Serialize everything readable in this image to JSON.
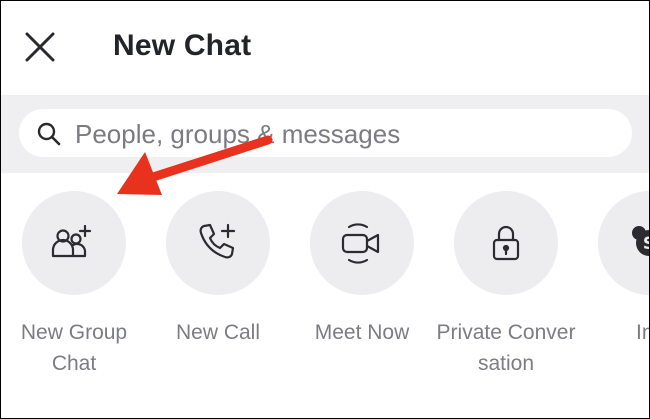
{
  "header": {
    "title": "New Chat",
    "close_icon": "close-icon"
  },
  "search": {
    "placeholder": "People, groups & messages",
    "icon": "search-icon"
  },
  "actions": [
    {
      "label": "New Group Chat",
      "icon": "group-add-icon"
    },
    {
      "label": "New Call",
      "icon": "phone-add-icon"
    },
    {
      "label": "Meet Now",
      "icon": "video-camera-icon"
    },
    {
      "label": "Private Conversation",
      "icon": "lock-icon"
    },
    {
      "label": "Inv",
      "icon": "skype-icon"
    }
  ],
  "colors": {
    "title": "#222429",
    "label": "#7c7c83",
    "search_band": "#efeff2",
    "circle": "#ededef",
    "annotation_arrow": "#e8321e"
  }
}
